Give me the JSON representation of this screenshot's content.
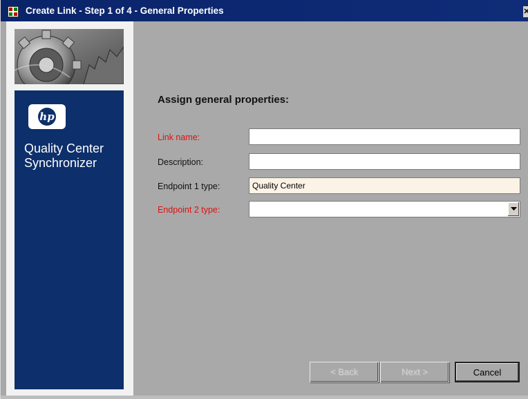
{
  "window": {
    "title": "Create Link - Step 1 of 4 - General Properties",
    "close_label": "✕"
  },
  "sidebar": {
    "logo_text": "hp",
    "product_name": "Quality Center Synchronizer"
  },
  "form": {
    "heading": "Assign general properties:",
    "fields": [
      {
        "label": "Link name:",
        "value": "",
        "required": true
      },
      {
        "label": "Description:",
        "value": "",
        "required": false
      },
      {
        "label": "Endpoint 1 type:",
        "value": "Quality Center",
        "required": false
      },
      {
        "label": "Endpoint 2 type:",
        "value": "",
        "required": true
      }
    ]
  },
  "buttons": {
    "back": "< Back",
    "next": "Next >",
    "cancel": "Cancel"
  },
  "colors": {
    "title_bar": "#0a246a",
    "brand_panel": "#0d2f6b",
    "required_label": "#e01010",
    "readonly_field": "#fbf3e6"
  }
}
